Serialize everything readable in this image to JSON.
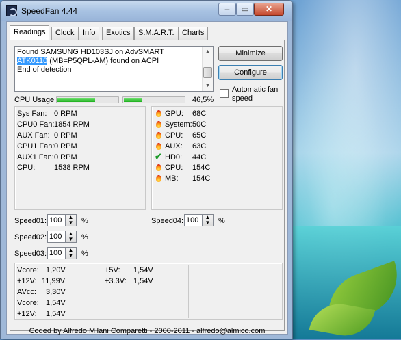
{
  "window": {
    "title": "SpeedFan 4.44",
    "controls": {
      "minimize": "–",
      "maximize": "▭",
      "close": "✕"
    }
  },
  "tabs": [
    "Readings",
    "Clock",
    "Info",
    "Exotics",
    "S.M.A.R.T.",
    "Charts"
  ],
  "log": {
    "line1": "Found SAMSUNG HD103SJ on AdvSMART",
    "line2_selected": "ATK0110",
    "line2_rest": " (MB=P5QPL-AM) found on ACPI",
    "line3": "End of detection"
  },
  "buttons": {
    "minimize": "Minimize",
    "configure": "Configure"
  },
  "auto_fan": {
    "label": "Automatic fan speed",
    "checked": false
  },
  "cpu_usage": {
    "label": "CPU Usage",
    "value": "46,5%",
    "bars": [
      0.62,
      0.31
    ]
  },
  "fans": [
    {
      "name": "Sys Fan:",
      "value": "0 RPM"
    },
    {
      "name": "CPU0 Fan:",
      "value": "1854 RPM"
    },
    {
      "name": "AUX Fan:",
      "value": "0 RPM"
    },
    {
      "name": "CPU1 Fan:",
      "value": "0 RPM"
    },
    {
      "name": "AUX1 Fan:",
      "value": "0 RPM"
    },
    {
      "name": "CPU:",
      "value": "1538 RPM"
    }
  ],
  "temps": [
    {
      "icon": "flame-icon",
      "name": "GPU:",
      "value": "68C"
    },
    {
      "icon": "flame-icon",
      "name": "System:",
      "value": "50C"
    },
    {
      "icon": "flame-icon",
      "name": "CPU:",
      "value": "65C"
    },
    {
      "icon": "flame-icon",
      "name": "AUX:",
      "value": "63C"
    },
    {
      "icon": "check-icon",
      "name": "HD0:",
      "value": "44C"
    },
    {
      "icon": "flame-icon",
      "name": "CPU:",
      "value": "154C"
    },
    {
      "icon": "flame-icon",
      "name": "MB:",
      "value": "154C"
    }
  ],
  "speeds": [
    {
      "label": "Speed01:",
      "value": "100",
      "unit": "%"
    },
    {
      "label": "Speed02:",
      "value": "100",
      "unit": "%"
    },
    {
      "label": "Speed03:",
      "value": "100",
      "unit": "%"
    },
    {
      "label": "Speed04:",
      "value": "100",
      "unit": "%"
    }
  ],
  "voltages_left": [
    {
      "name": "Vcore:",
      "value": "1,20V"
    },
    {
      "name": "+12V:",
      "value": "11,99V"
    },
    {
      "name": "AVcc:",
      "value": "3,30V"
    },
    {
      "name": "Vcore:",
      "value": "1,54V"
    },
    {
      "name": "+12V:",
      "value": "1,54V"
    }
  ],
  "voltages_right": [
    {
      "name": "+5V:",
      "value": "1,54V"
    },
    {
      "name": "+3.3V:",
      "value": "1,54V"
    }
  ],
  "footer": "Coded by Alfredo Milani Comparetti - 2000-2011 - alfredo@almico.com",
  "colors": {
    "selection": "#3399ff",
    "bar": "#20b020",
    "flame": "#d9260f",
    "check": "#1e9c2a"
  }
}
